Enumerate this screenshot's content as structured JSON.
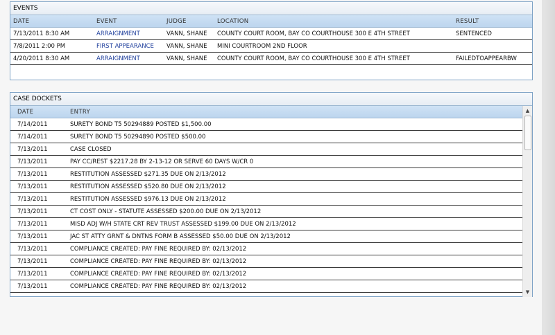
{
  "events": {
    "title": "EVENTS",
    "columns": [
      "DATE",
      "EVENT",
      "JUDGE",
      "LOCATION",
      "RESULT"
    ],
    "rows": [
      {
        "date": "7/13/2011 8:30 AM",
        "event": "ARRAIGNMENT",
        "judge": "VANN, SHANE",
        "location": "COUNTY COURT ROOM, BAY CO COURTHOUSE 300 E 4TH STREET",
        "result": "SENTENCED"
      },
      {
        "date": "7/8/2011 2:00 PM",
        "event": "FIRST APPEARANCE",
        "judge": "VANN, SHANE",
        "location": "MINI COURTROOM 2ND FLOOR",
        "result": ""
      },
      {
        "date": "4/20/2011 8:30 AM",
        "event": "ARRAIGNMENT",
        "judge": "VANN, SHANE",
        "location": "COUNTY COURT ROOM, BAY CO COURTHOUSE 300 E 4TH STREET",
        "result": "FAILEDTOAPPEARBW"
      }
    ]
  },
  "dockets": {
    "title": "CASE DOCKETS",
    "columns": [
      "DATE",
      "ENTRY"
    ],
    "rows": [
      {
        "date": "7/14/2011",
        "entry": "SURETY BOND T5 50294889 POSTED $1,500.00"
      },
      {
        "date": "7/14/2011",
        "entry": "SURETY BOND T5 50294890 POSTED $500.00"
      },
      {
        "date": "7/13/2011",
        "entry": "CASE CLOSED"
      },
      {
        "date": "7/13/2011",
        "entry": "PAY CC/REST $2217.28 BY 2-13-12 OR SERVE 60 DAYS W/CR 0"
      },
      {
        "date": "7/13/2011",
        "entry": "RESTITUTION ASSESSED $271.35 DUE ON 2/13/2012"
      },
      {
        "date": "7/13/2011",
        "entry": "RESTITUTION ASSESSED $520.80 DUE ON 2/13/2012"
      },
      {
        "date": "7/13/2011",
        "entry": "RESTITUTION ASSESSED $976.13 DUE ON 2/13/2012"
      },
      {
        "date": "7/13/2011",
        "entry": "CT COST ONLY - STATUTE ASSESSED $200.00 DUE ON 2/13/2012"
      },
      {
        "date": "7/13/2011",
        "entry": "MISD ADJ W/H STATE CRT REV TRUST ASSESSED $199.00 DUE ON 2/13/2012"
      },
      {
        "date": "7/13/2011",
        "entry": "JAC ST ATTY GRNT & DNTNS FORM B ASSESSED $50.00 DUE ON 2/13/2012"
      },
      {
        "date": "7/13/2011",
        "entry": "COMPLIANCE CREATED: PAY FINE REQUIRED BY: 02/13/2012"
      },
      {
        "date": "7/13/2011",
        "entry": "COMPLIANCE CREATED: PAY FINE REQUIRED BY: 02/13/2012"
      },
      {
        "date": "7/13/2011",
        "entry": "COMPLIANCE CREATED: PAY FINE REQUIRED BY: 02/13/2012"
      },
      {
        "date": "7/13/2011",
        "entry": "COMPLIANCE CREATED: PAY FINE REQUIRED BY: 02/13/2012"
      }
    ],
    "scroll_up_icon": "up-arrow-icon",
    "scroll_down_icon": "down-arrow-icon"
  }
}
